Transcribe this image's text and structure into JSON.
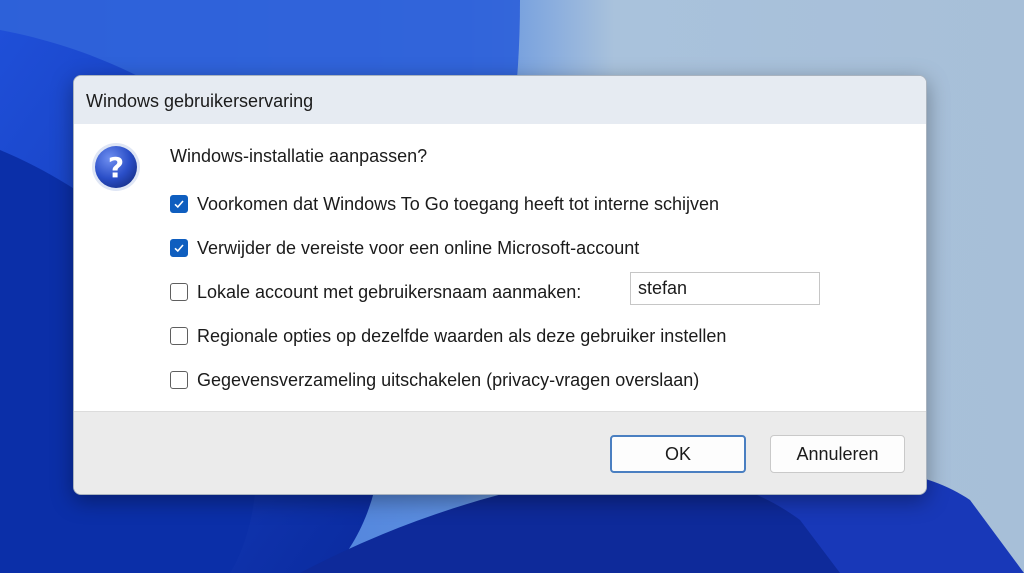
{
  "dialog": {
    "title": "Windows gebruikerservaring",
    "heading": "Windows-installatie aanpassen?",
    "icon": "question-icon"
  },
  "options": [
    {
      "label": "Voorkomen dat Windows To Go toegang heeft tot interne schijven",
      "checked": true
    },
    {
      "label": "Verwijder de vereiste voor een online Microsoft-account",
      "checked": true
    },
    {
      "label": "Lokale account met gebruikersnaam aanmaken:",
      "checked": false
    },
    {
      "label": "Regionale opties op dezelfde waarden als deze gebruiker instellen",
      "checked": false
    },
    {
      "label": "Gegevensverzameling uitschakelen (privacy-vragen overslaan)",
      "checked": false
    }
  ],
  "username": {
    "value": "stefan"
  },
  "buttons": {
    "ok": "OK",
    "cancel": "Annuleren"
  },
  "colors": {
    "accent": "#0f5ebf",
    "titlebar": "#e6ebf2",
    "footer": "#ebebeb"
  }
}
